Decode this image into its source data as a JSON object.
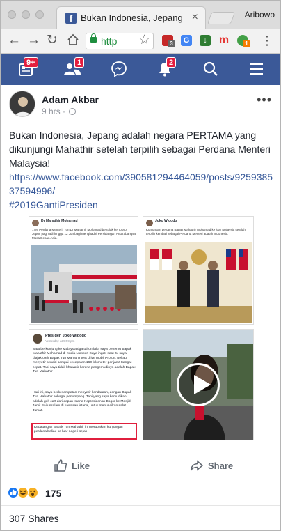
{
  "browser": {
    "tab_title": "Bukan Indonesia, Jepang adala",
    "profile_name": "Aribowo",
    "url_text": "http",
    "extension_badges": {
      "ext1": "3",
      "ext2": "1"
    }
  },
  "fb_nav": {
    "feed_badge": "9+",
    "friends_badge": "1",
    "notifications_badge": "2"
  },
  "post": {
    "author": "Adam Akbar",
    "time": "9 hrs",
    "separator": "·",
    "text": "Bukan Indonesia, Jepang adalah negara PERTAMA yang dikunjungi Mahathir setelah terpilih sebagai Perdana Menteri Malaysia!",
    "link": "https://www.facebook.com/390581294464059/posts/925938537594996/",
    "hashtag": "#2019GantiPresiden",
    "images": {
      "tl_author": "Dr Mahathir Mohamad",
      "tl_caption": "1TM Perdana Menteri, Tun Dr Mahathir Mohamad bertolak ke Tokyo, Jepun pagi tadi hingga 12 Jun bagi menghadiri Persidangan Antarabangsa Masa Depan Asia.",
      "tr_author": "Joko Widodo",
      "tr_caption": "Kunjungan pertama Bapak Mahathir Mohamad ke luar Malaysia setelah terpilih kembali sebagai Perdana Menteri adalah Indonesia.",
      "bl_author": "Presiden Joko Widodo",
      "bl_time": "Yesterday at 9:59 pm",
      "bl_p1": "Saat berkunjung ke Malaysia tiga tahun lalu, saya bertemu Bapak Mahathir Mohamad di Kuala Lumpur. Saya ingat, saat itu saya diajak oleh Bapak Tun Mahathir test drive mobil Proton. Beliau menyetir sendiri sampai kecepatan 160 kilometer per jam! Sangat cepat. Tapi saya tidak khawatir karena pengemudinya adalah Bapak Tun Mahathir",
      "bl_p2": "Hari ini, saya berkesempatan menyetir kendaraan, dengan Bapak Tun Mahathir sebagai penumpang. Tapi yang saya kemudikan adalah golf cart dari depan Istana Kepresidenan Bogor ke Masjid Jami' Baitussalam di kawasan istana, untuk menunaikan salat Jumat.",
      "bl_p3": "Kedatangan Bapak Tun Mahathir ini merupakan kunjungan perdana beliau ke luar negeri sejak"
    },
    "like_label": "Like",
    "share_label": "Share",
    "reaction_count": "175",
    "shares_label": "307 Shares"
  },
  "colors": {
    "fb_blue": "#3b5998",
    "link_blue": "#365899",
    "badge_red": "#e41e3f"
  },
  "icons": [
    "facebook-favicon-icon",
    "back-icon",
    "forward-icon",
    "reload-icon",
    "home-icon",
    "lock-icon",
    "star-icon",
    "feed-icon",
    "friends-icon",
    "messenger-icon",
    "bell-icon",
    "search-icon",
    "menu-icon",
    "globe-icon",
    "like-icon",
    "share-icon",
    "play-icon"
  ]
}
